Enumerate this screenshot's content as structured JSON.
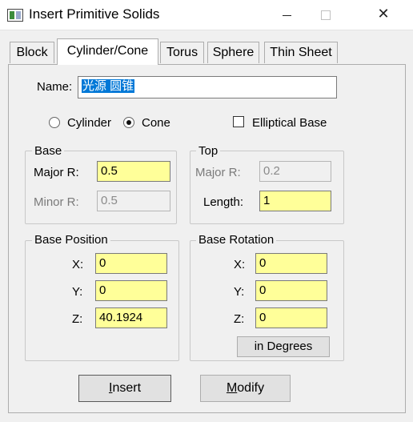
{
  "window": {
    "title": "Insert Primitive Solids",
    "minimize": "—",
    "close": "✕"
  },
  "tabs": [
    {
      "label": "Block"
    },
    {
      "label": "Cylinder/Cone"
    },
    {
      "label": "Torus"
    },
    {
      "label": "Sphere"
    },
    {
      "label": "Thin Sheet"
    }
  ],
  "name": {
    "label": "Name:",
    "value": "光源 圆锥"
  },
  "shape": {
    "cylinder_label": "Cylinder",
    "cone_label": "Cone",
    "selected": "Cone",
    "elliptical_label": "Elliptical Base",
    "elliptical_checked": false
  },
  "base": {
    "title": "Base",
    "major_label": "Major R:",
    "major_value": "0.5",
    "minor_label": "Minor R:",
    "minor_value": "0.5"
  },
  "top": {
    "title": "Top",
    "major_label": "Major R:",
    "major_value": "0.2",
    "length_label": "Length:",
    "length_value": "1"
  },
  "base_position": {
    "title": "Base Position",
    "x_label": "X:",
    "x_value": "0",
    "y_label": "Y:",
    "y_value": "0",
    "z_label": "Z:",
    "z_value": "40.1924"
  },
  "base_rotation": {
    "title": "Base Rotation",
    "x_label": "X:",
    "x_value": "0",
    "y_label": "Y:",
    "y_value": "0",
    "z_label": "Z:",
    "z_value": "0",
    "units_button": "in Degrees"
  },
  "actions": {
    "insert_rest": "nsert",
    "insert_mnemonic": "I",
    "modify_rest": "odify",
    "modify_mnemonic": "M"
  },
  "colors": {
    "field_active": "#ffff99",
    "selection": "#0078d7"
  }
}
